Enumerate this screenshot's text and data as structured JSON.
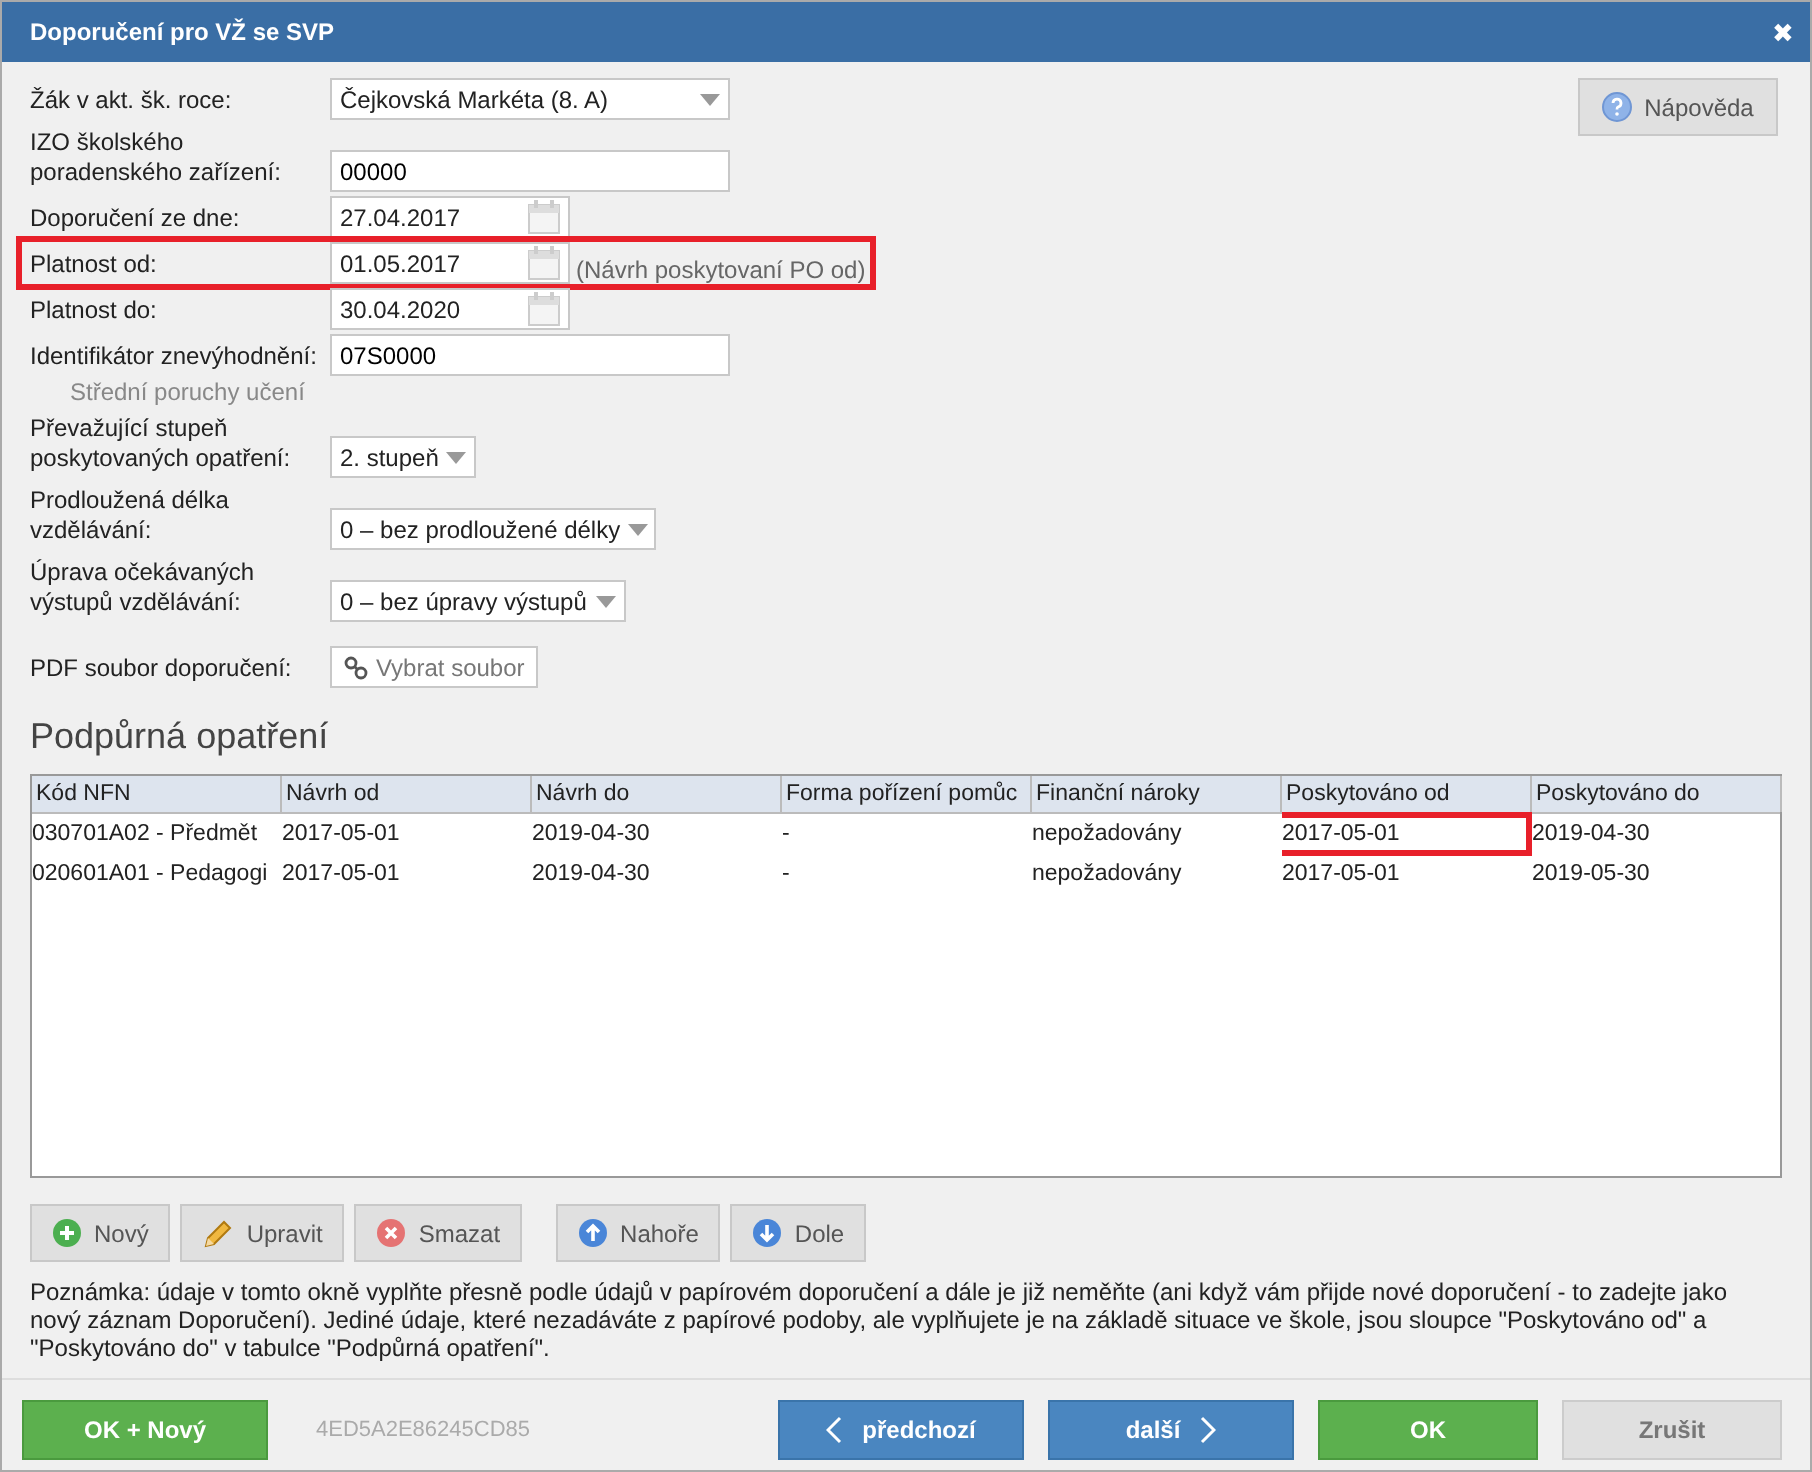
{
  "window": {
    "title": "Doporučení pro VŽ se SVP",
    "close": "✖"
  },
  "help_button": "Nápověda",
  "form": [
    {
      "kind": "select",
      "label": "Žák v akt. šk. roce:",
      "value": "Čejkovská Markéta (8. A)"
    },
    {
      "kind": "text",
      "label": "IZO školského poradenského zařízení:",
      "value": "00000"
    },
    {
      "kind": "date",
      "label": "Doporučení ze dne:",
      "value": "27.04.2017",
      "highlighted": false
    },
    {
      "kind": "date",
      "label": "Platnost od:",
      "value": "01.05.2017",
      "hint": "(Návrh poskytovaní PO od)",
      "highlighted": true
    },
    {
      "kind": "date",
      "label": "Platnost do:",
      "value": "30.04.2020",
      "highlighted": false
    },
    {
      "kind": "text",
      "label": "Identifikátor znevýhodnění:",
      "value": "07S0000",
      "subtitle": "Střední poruchy učení"
    },
    {
      "kind": "select",
      "label": "Převažující stupeň poskytovaných opatření:",
      "value": "2. stupeň"
    },
    {
      "kind": "select",
      "label": "Prodloužená délka vzdělávání:",
      "value": "0 – bez prodloužené délky"
    },
    {
      "kind": "select",
      "label": "Úprava očekávaných výstupů vzdělávání:",
      "value": "0 – bez úpravy výstupů"
    },
    {
      "kind": "file",
      "label": "PDF soubor doporučení:",
      "value": "Vybrat soubor"
    }
  ],
  "section_title": "Podpůrná opatření",
  "table": {
    "columns": [
      "Kód NFN",
      "Návrh od",
      "Návrh do",
      "Forma pořízení pomůc",
      "Finanční nároky",
      "Poskytováno od",
      "Poskytováno do"
    ],
    "rows": [
      {
        "cells": [
          "030701A02 - Předmět",
          "2017-05-01",
          "2019-04-30",
          "-",
          "nepožadovány",
          "2017-05-01",
          "2019-04-30"
        ],
        "provided_from_highlighted": true
      },
      {
        "cells": [
          "020601A01 - Pedagogi",
          "2017-05-01",
          "2019-04-30",
          "-",
          "nepožadovány",
          "2017-05-01",
          "2019-05-30"
        ],
        "provided_from_highlighted": false
      }
    ]
  },
  "table_buttons": [
    "Nový",
    "Upravit",
    "Smazat",
    "Nahoře",
    "Dole"
  ],
  "note": "Poznámka: údaje v tomto okně vyplňte přesně podle údajů v papírovém doporučení a dále je již neměňte (ani když vám přijde nové doporučení - to zadejte jako nový záznam Doporučení). Jediné údaje, které nezadáváte z papírové podoby, ale vyplňujete je na základě situace ve škole, jsou sloupce \"Poskytováno od\" a \"Poskytováno do\" v tabulce \"Podpůrná opatření\".",
  "footer": {
    "ok_new": "OK + Nový",
    "code": "4ED5A2E86245CD85",
    "prev": "předchozí",
    "next": "další",
    "ok": "OK",
    "cancel": "Zrušit"
  }
}
